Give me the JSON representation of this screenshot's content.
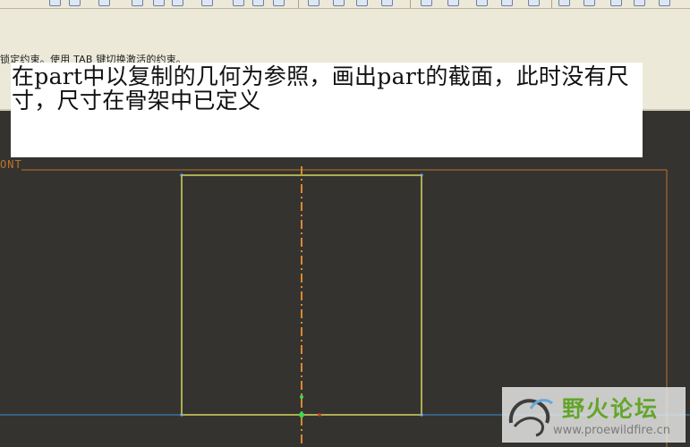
{
  "status_message": "锁定约束。使用 TAB 键切换激活的约束。",
  "annotation": {
    "text": "在part中以复制的几何为参照，画出part的截面，此时没有尺寸，尺寸在骨架中已定义"
  },
  "canvas": {
    "plane_label": "ONT",
    "colors": {
      "background": "#35332f",
      "sketch_rectangle": "#ffff66",
      "centerline": "#d98a2c",
      "datum_frame": "#b8752f",
      "reference_line": "#3b8fd6",
      "constraint_point": "#33dd55",
      "origin_mark": "#e03030"
    }
  },
  "watermark": {
    "name": "野火论坛",
    "url": "www.proewildfire.cn"
  }
}
